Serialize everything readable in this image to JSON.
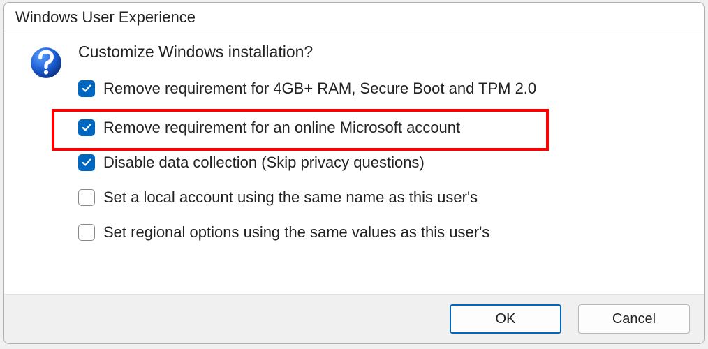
{
  "dialog": {
    "title": "Windows User Experience",
    "heading": "Customize Windows installation?",
    "options": [
      {
        "label": "Remove requirement for 4GB+ RAM, Secure Boot and TPM 2.0",
        "checked": true,
        "highlighted": false
      },
      {
        "label": "Remove requirement for an online Microsoft account",
        "checked": true,
        "highlighted": true
      },
      {
        "label": "Disable data collection (Skip privacy questions)",
        "checked": true,
        "highlighted": false
      },
      {
        "label": "Set a local account using the same name as this user's",
        "checked": false,
        "highlighted": false
      },
      {
        "label": "Set regional options using the same values as this user's",
        "checked": false,
        "highlighted": false
      }
    ],
    "buttons": {
      "ok": "OK",
      "cancel": "Cancel"
    }
  }
}
